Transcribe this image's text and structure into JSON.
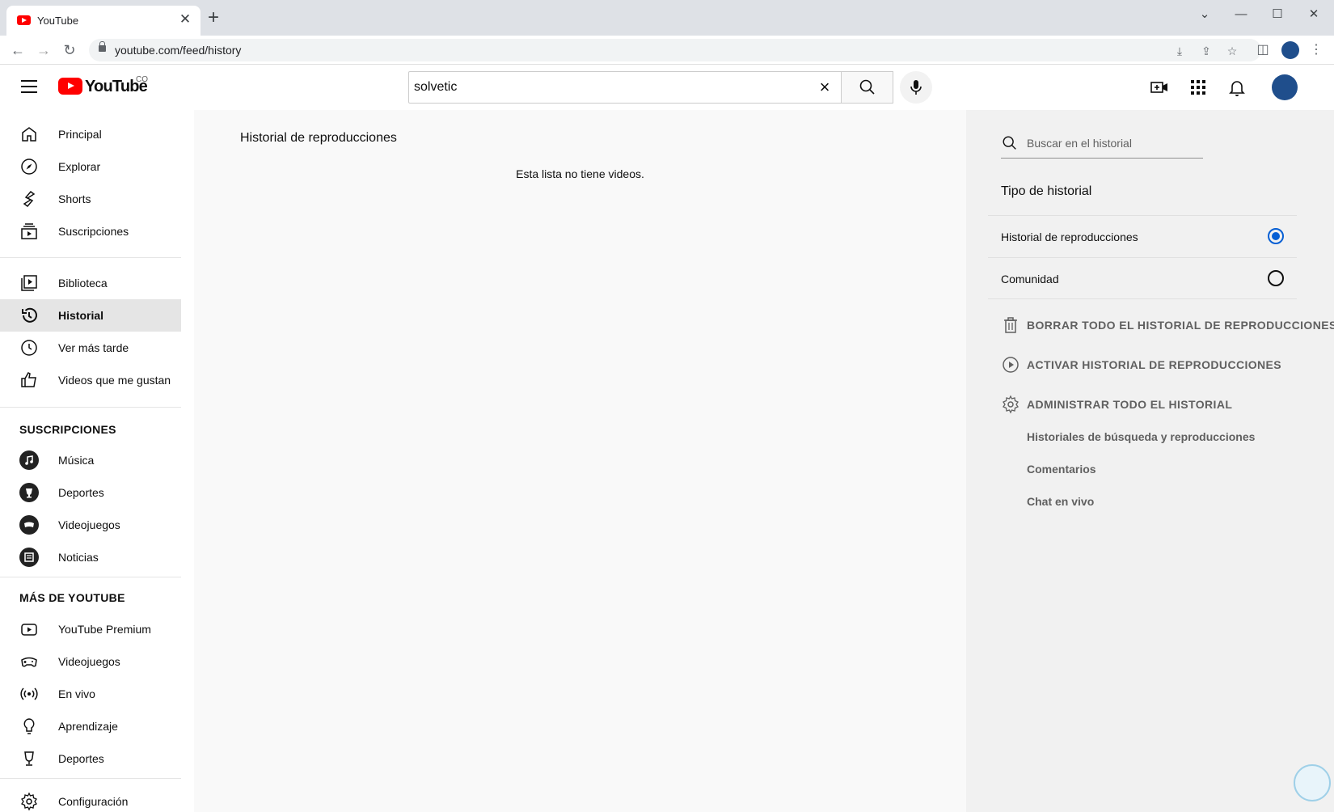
{
  "browser": {
    "tab_title": "YouTube",
    "url": "youtube.com/feed/history"
  },
  "header": {
    "logo_text": "YouTube",
    "country_code": "CO",
    "search_value": "solvetic"
  },
  "sidebar": {
    "main_items": [
      {
        "label": "Principal",
        "icon": "home-icon"
      },
      {
        "label": "Explorar",
        "icon": "compass-icon"
      },
      {
        "label": "Shorts",
        "icon": "shorts-icon"
      },
      {
        "label": "Suscripciones",
        "icon": "subscriptions-icon"
      }
    ],
    "library_items": [
      {
        "label": "Biblioteca",
        "icon": "library-icon"
      },
      {
        "label": "Historial",
        "icon": "history-icon",
        "active": true
      },
      {
        "label": "Ver más tarde",
        "icon": "clock-icon"
      },
      {
        "label": "Videos que me gustan",
        "icon": "thumbs-up-icon"
      }
    ],
    "subscriptions_title": "SUSCRIPCIONES",
    "subscriptions": [
      {
        "label": "Música",
        "icon": "music-icon"
      },
      {
        "label": "Deportes",
        "icon": "trophy-icon"
      },
      {
        "label": "Videojuegos",
        "icon": "gamepad-icon"
      },
      {
        "label": "Noticias",
        "icon": "newspaper-icon"
      }
    ],
    "more_title": "MÁS DE YOUTUBE",
    "more_items": [
      {
        "label": "YouTube Premium",
        "icon": "youtube-premium-icon"
      },
      {
        "label": "Videojuegos",
        "icon": "gamepad-icon"
      },
      {
        "label": "En vivo",
        "icon": "live-icon"
      },
      {
        "label": "Aprendizaje",
        "icon": "lightbulb-icon"
      },
      {
        "label": "Deportes",
        "icon": "trophy-icon"
      }
    ],
    "settings_label": "Configuración"
  },
  "main": {
    "title": "Historial de reproducciones",
    "empty_message": "Esta lista no tiene videos."
  },
  "right_panel": {
    "search_placeholder": "Buscar en el historial",
    "type_title": "Tipo de historial",
    "options": [
      {
        "label": "Historial de reproducciones",
        "selected": true
      },
      {
        "label": "Comunidad",
        "selected": false
      }
    ],
    "actions": [
      {
        "label": "BORRAR TODO EL HISTORIAL DE REPRODUCCIONES",
        "icon": "trash-icon"
      },
      {
        "label": "ACTIVAR HISTORIAL DE REPRODUCCIONES",
        "icon": "play-circle-icon"
      },
      {
        "label": "ADMINISTRAR TODO EL HISTORIAL",
        "icon": "gear-icon"
      }
    ],
    "sub_links": [
      "Historiales de búsqueda y reproducciones",
      "Comentarios",
      "Chat en vivo"
    ]
  },
  "colors": {
    "accent": "#065fd4",
    "brand_red": "#ff0000",
    "active_bg": "#e5e5e5"
  }
}
